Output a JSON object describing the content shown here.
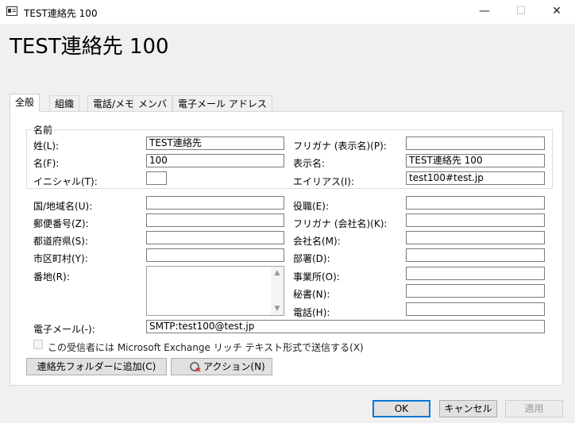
{
  "window": {
    "title": "TEST連絡先 100",
    "minimize": "—",
    "maximize": "☐",
    "close": "✕"
  },
  "heading": "TEST連絡先 100",
  "tabs": [
    "全般",
    "組織",
    "電話/メモ",
    "メンバ",
    "電子メール アドレス"
  ],
  "name_group": {
    "label": "名前",
    "last_name_label": "姓(L):",
    "last_name_value": "TEST連絡先",
    "first_name_label": "名(F):",
    "first_name_value": "100",
    "initials_label": "イニシャル(T):",
    "initials_value": "",
    "furigana_display_label": "フリガナ (表示名)(P):",
    "furigana_display_value": "",
    "display_name_label": "表示名:",
    "display_name_value": "TEST連絡先 100",
    "alias_label": "エイリアス(I):",
    "alias_value": "test100#test.jp"
  },
  "address": {
    "country_label": "国/地域名(U):",
    "country_value": "",
    "postal_label": "郵便番号(Z):",
    "postal_value": "",
    "state_label": "都道府県(S):",
    "state_value": "",
    "city_label": "市区町村(Y):",
    "city_value": "",
    "street_label": "番地(R):",
    "street_value": ""
  },
  "organization": {
    "title_label": "役職(E):",
    "title_value": "",
    "furigana_company_label": "フリガナ (会社名)(K):",
    "furigana_company_value": "",
    "company_label": "会社名(M):",
    "company_value": "",
    "department_label": "部署(D):",
    "department_value": "",
    "office_label": "事業所(O):",
    "office_value": "",
    "assistant_label": "秘書(N):",
    "assistant_value": "",
    "phone_label": "電話(H):",
    "phone_value": ""
  },
  "email": {
    "label": "電子メール(-):",
    "value": "SMTP:test100@test.jp"
  },
  "rich_text_checkbox": "この受信者には Microsoft Exchange リッチ テキスト形式で送信する(X)",
  "buttons": {
    "add_to_contacts": "連絡先フォルダーに追加(C)",
    "actions": "アクション(N)",
    "ok": "OK",
    "cancel": "キャンセル",
    "apply": "適用"
  }
}
